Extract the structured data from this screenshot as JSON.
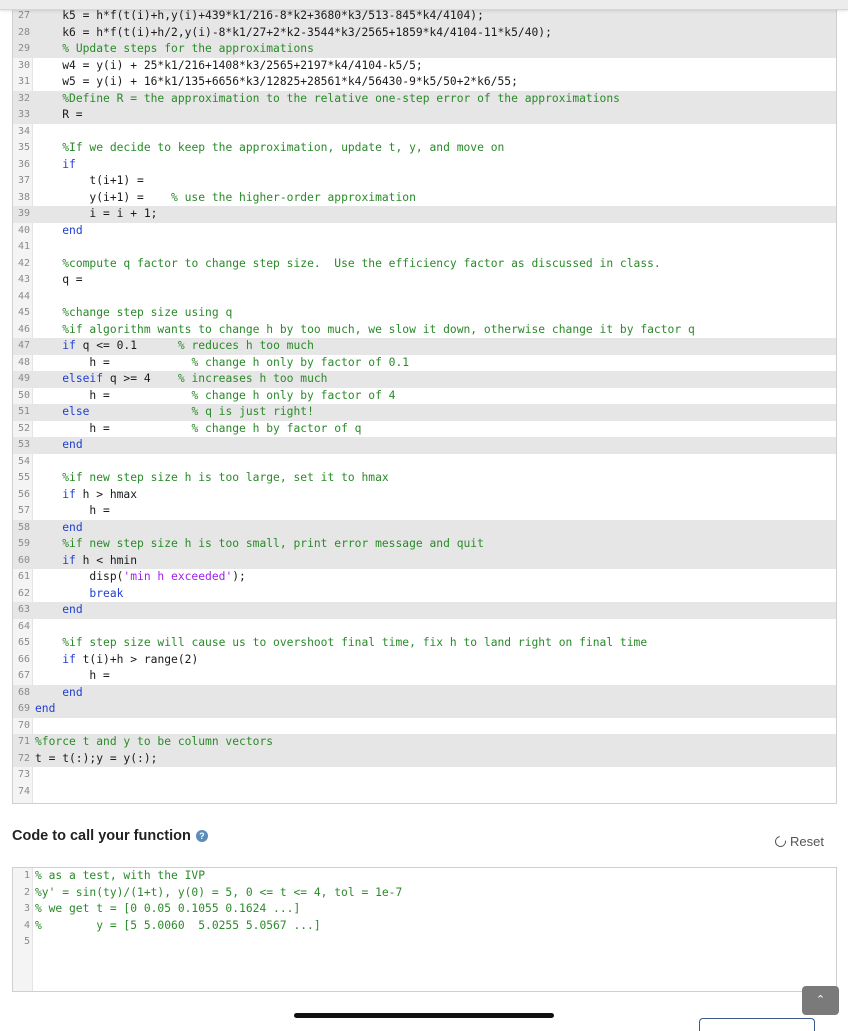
{
  "editor": {
    "lines": [
      {
        "n": "27",
        "hl": true,
        "parts": [
          [
            "t",
            "    k5 = h*f(t(i)+h,y(i)+439*k1/216-8*k2+3680*k3/513-845*k4/4104);"
          ]
        ]
      },
      {
        "n": "28",
        "hl": true,
        "parts": [
          [
            "t",
            "    k6 = h*f(t(i)+h/2,y(i)-8*k1/27+2*k2-3544*k3/2565+1859*k4/4104-11*k5/40);"
          ]
        ]
      },
      {
        "n": "29",
        "hl": true,
        "parts": [
          [
            "t",
            "    "
          ],
          [
            "c",
            "% Update steps for the approximations"
          ]
        ]
      },
      {
        "n": "30",
        "hl": false,
        "parts": [
          [
            "t",
            "    w4 = y(i) + 25*k1/216+1408*k3/2565+2197*k4/4104-k5/5;"
          ]
        ]
      },
      {
        "n": "31",
        "hl": false,
        "parts": [
          [
            "t",
            "    w5 = y(i) + 16*k1/135+6656*k3/12825+28561*k4/56430-9*k5/50+2*k6/55;"
          ]
        ]
      },
      {
        "n": "32",
        "hl": true,
        "parts": [
          [
            "t",
            "    "
          ],
          [
            "c",
            "%Define R = the approximation to the relative one-step error of the approximations"
          ]
        ]
      },
      {
        "n": "33",
        "hl": true,
        "parts": [
          [
            "t",
            "    R = "
          ]
        ]
      },
      {
        "n": "34",
        "hl": false,
        "parts": [
          [
            "t",
            ""
          ]
        ]
      },
      {
        "n": "35",
        "hl": false,
        "parts": [
          [
            "t",
            "    "
          ],
          [
            "c",
            "%If we decide to keep the approximation, update t, y, and move on"
          ]
        ]
      },
      {
        "n": "36",
        "hl": false,
        "parts": [
          [
            "t",
            "    "
          ],
          [
            "k",
            "if"
          ]
        ]
      },
      {
        "n": "37",
        "hl": false,
        "parts": [
          [
            "t",
            "        t(i+1) = "
          ]
        ]
      },
      {
        "n": "38",
        "hl": false,
        "parts": [
          [
            "t",
            "        y(i+1) =    "
          ],
          [
            "c",
            "% use the higher-order approximation"
          ]
        ]
      },
      {
        "n": "39",
        "hl": true,
        "parts": [
          [
            "t",
            "        i = i + 1;"
          ]
        ]
      },
      {
        "n": "40",
        "hl": false,
        "parts": [
          [
            "t",
            "    "
          ],
          [
            "k",
            "end"
          ]
        ]
      },
      {
        "n": "41",
        "hl": false,
        "parts": [
          [
            "t",
            ""
          ]
        ]
      },
      {
        "n": "42",
        "hl": false,
        "parts": [
          [
            "t",
            "    "
          ],
          [
            "c",
            "%compute q factor to change step size.  Use the efficiency factor as discussed in class."
          ]
        ]
      },
      {
        "n": "43",
        "hl": false,
        "parts": [
          [
            "t",
            "    q = "
          ]
        ]
      },
      {
        "n": "44",
        "hl": false,
        "parts": [
          [
            "t",
            ""
          ]
        ]
      },
      {
        "n": "45",
        "hl": false,
        "parts": [
          [
            "t",
            "    "
          ],
          [
            "c",
            "%change step size using q"
          ]
        ]
      },
      {
        "n": "46",
        "hl": false,
        "parts": [
          [
            "t",
            "    "
          ],
          [
            "c",
            "%if algorithm wants to change h by too much, we slow it down, otherwise change it by factor q"
          ]
        ]
      },
      {
        "n": "47",
        "hl": true,
        "parts": [
          [
            "t",
            "    "
          ],
          [
            "k",
            "if"
          ],
          [
            "t",
            " q <= 0.1      "
          ],
          [
            "c",
            "% reduces h too much"
          ]
        ]
      },
      {
        "n": "48",
        "hl": false,
        "parts": [
          [
            "t",
            "        h =            "
          ],
          [
            "c",
            "% change h only by factor of 0.1"
          ]
        ]
      },
      {
        "n": "49",
        "hl": true,
        "parts": [
          [
            "t",
            "    "
          ],
          [
            "k",
            "elseif"
          ],
          [
            "t",
            " q >= 4    "
          ],
          [
            "c",
            "% increases h too much"
          ]
        ]
      },
      {
        "n": "50",
        "hl": false,
        "parts": [
          [
            "t",
            "        h =            "
          ],
          [
            "c",
            "% change h only by factor of 4"
          ]
        ]
      },
      {
        "n": "51",
        "hl": true,
        "parts": [
          [
            "t",
            "    "
          ],
          [
            "k",
            "else"
          ],
          [
            "t",
            "               "
          ],
          [
            "c",
            "% q is just right!"
          ]
        ]
      },
      {
        "n": "52",
        "hl": false,
        "parts": [
          [
            "t",
            "        h =            "
          ],
          [
            "c",
            "% change h by factor of q"
          ]
        ]
      },
      {
        "n": "53",
        "hl": true,
        "parts": [
          [
            "t",
            "    "
          ],
          [
            "k",
            "end"
          ]
        ]
      },
      {
        "n": "54",
        "hl": false,
        "parts": [
          [
            "t",
            ""
          ]
        ]
      },
      {
        "n": "55",
        "hl": false,
        "parts": [
          [
            "t",
            "    "
          ],
          [
            "c",
            "%if new step size h is too large, set it to hmax"
          ]
        ]
      },
      {
        "n": "56",
        "hl": false,
        "parts": [
          [
            "t",
            "    "
          ],
          [
            "k",
            "if"
          ],
          [
            "t",
            " h > hmax"
          ]
        ]
      },
      {
        "n": "57",
        "hl": false,
        "parts": [
          [
            "t",
            "        h = "
          ]
        ]
      },
      {
        "n": "58",
        "hl": true,
        "parts": [
          [
            "t",
            "    "
          ],
          [
            "k",
            "end"
          ]
        ]
      },
      {
        "n": "59",
        "hl": true,
        "parts": [
          [
            "t",
            "    "
          ],
          [
            "c",
            "%if new step size h is too small, print error message and quit"
          ]
        ]
      },
      {
        "n": "60",
        "hl": true,
        "parts": [
          [
            "t",
            "    "
          ],
          [
            "k",
            "if"
          ],
          [
            "t",
            " h < hmin"
          ]
        ]
      },
      {
        "n": "61",
        "hl": false,
        "parts": [
          [
            "t",
            "        disp("
          ],
          [
            "s",
            "'min h exceeded'"
          ],
          [
            "t",
            ");"
          ]
        ]
      },
      {
        "n": "62",
        "hl": false,
        "parts": [
          [
            "t",
            "        "
          ],
          [
            "k",
            "break"
          ]
        ]
      },
      {
        "n": "63",
        "hl": true,
        "parts": [
          [
            "t",
            "    "
          ],
          [
            "k",
            "end"
          ]
        ]
      },
      {
        "n": "64",
        "hl": false,
        "parts": [
          [
            "t",
            ""
          ]
        ]
      },
      {
        "n": "65",
        "hl": false,
        "parts": [
          [
            "t",
            "    "
          ],
          [
            "c",
            "%if step size will cause us to overshoot final time, fix h to land right on final time"
          ]
        ]
      },
      {
        "n": "66",
        "hl": false,
        "parts": [
          [
            "t",
            "    "
          ],
          [
            "k",
            "if"
          ],
          [
            "t",
            " t(i)+h > range(2)"
          ]
        ]
      },
      {
        "n": "67",
        "hl": false,
        "parts": [
          [
            "t",
            "        h = "
          ]
        ]
      },
      {
        "n": "68",
        "hl": true,
        "parts": [
          [
            "t",
            "    "
          ],
          [
            "k",
            "end"
          ]
        ]
      },
      {
        "n": "69",
        "hl": true,
        "parts": [
          [
            "k",
            "end"
          ]
        ]
      },
      {
        "n": "70",
        "hl": false,
        "parts": [
          [
            "t",
            ""
          ]
        ]
      },
      {
        "n": "71",
        "hl": true,
        "parts": [
          [
            "c",
            "%force t and y to be column vectors"
          ]
        ]
      },
      {
        "n": "72",
        "hl": true,
        "parts": [
          [
            "t",
            "t = t(:);y = y(:);"
          ]
        ]
      },
      {
        "n": "73",
        "hl": false,
        "parts": [
          [
            "t",
            ""
          ]
        ]
      },
      {
        "n": "74",
        "hl": false,
        "parts": [
          [
            "t",
            ""
          ]
        ]
      }
    ]
  },
  "call_section": {
    "title": "Code to call your function",
    "help_icon": "question-circle-icon",
    "help_glyph": "?",
    "reset_label": "Reset",
    "reset_icon": "refresh-icon",
    "lines": [
      {
        "n": "1",
        "hl": false,
        "parts": [
          [
            "c",
            "% as a test, with the IVP"
          ]
        ]
      },
      {
        "n": "2",
        "hl": false,
        "parts": [
          [
            "c",
            "%y' = sin(ty)/(1+t), y(0) = 5, 0 <= t <= 4, tol = 1e-7"
          ]
        ]
      },
      {
        "n": "3",
        "hl": false,
        "parts": [
          [
            "c",
            "% we get t = [0 0.05 0.1055 0.1624 ...]"
          ]
        ]
      },
      {
        "n": "4",
        "hl": false,
        "parts": [
          [
            "c",
            "%        y = [5 5.0060  5.0255 5.0567 ...]"
          ]
        ]
      },
      {
        "n": "5",
        "hl": false,
        "parts": [
          [
            "t",
            ""
          ]
        ]
      }
    ]
  },
  "scroll_top": {
    "icon": "chevron-up-icon",
    "glyph": "⌃"
  },
  "colors": {
    "keyword": "#1f3fd1",
    "comment": "#2a8a2a",
    "string": "#a020f0",
    "highlight": "#e6e6e6"
  }
}
